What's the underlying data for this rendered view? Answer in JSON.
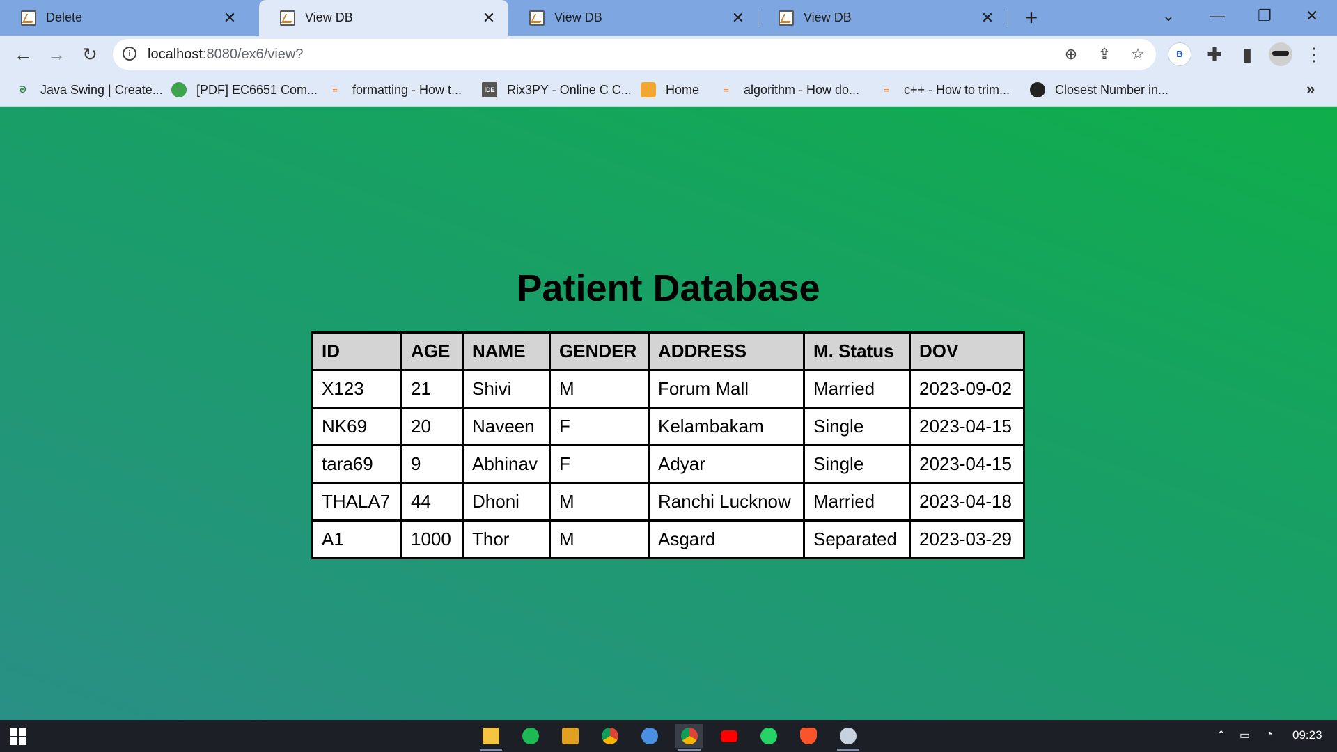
{
  "browser": {
    "tabs": [
      {
        "title": "Delete",
        "active": false
      },
      {
        "title": "View DB",
        "active": true
      },
      {
        "title": "View DB",
        "active": false
      },
      {
        "title": "View DB",
        "active": false
      }
    ],
    "new_tab_icon": "plus-icon",
    "url_host": "localhost",
    "url_path": ":8080/ex6/view?",
    "profile_initial": "B",
    "bookmarks": [
      {
        "label": "Java Swing | Create...",
        "icon": "geeksforgeeks-icon"
      },
      {
        "label": "[PDF] EC6651 Com...",
        "icon": "globe-colorful-icon"
      },
      {
        "label": "formatting - How t...",
        "icon": "stackoverflow-icon"
      },
      {
        "label": "Rix3PY - Online C C...",
        "icon": "ideone-icon"
      },
      {
        "label": "Home",
        "icon": "box-icon"
      },
      {
        "label": "algorithm - How do...",
        "icon": "stackoverflow-icon"
      },
      {
        "label": "c++ - How to trim...",
        "icon": "stackoverflow-icon"
      },
      {
        "label": "Closest Number in...",
        "icon": "globe-icon"
      }
    ]
  },
  "page": {
    "title": "Patient Database",
    "table": {
      "headers": [
        "ID",
        "AGE",
        "NAME",
        "GENDER",
        "ADDRESS",
        "M. Status",
        "DOV"
      ],
      "rows": [
        [
          "X123",
          "21",
          "Shivi",
          "M",
          "Forum Mall",
          "Married",
          "2023-09-02"
        ],
        [
          "NK69",
          "20",
          "Naveen",
          "F",
          "Kelambakam",
          "Single",
          "2023-04-15"
        ],
        [
          "tara69",
          "9",
          "Abhinav",
          "F",
          "Adyar",
          "Single",
          "2023-04-15"
        ],
        [
          "THALA7",
          "44",
          "Dhoni",
          "M",
          "Ranchi Lucknow",
          "Married",
          "2023-04-18"
        ],
        [
          "A1",
          "1000",
          "Thor",
          "M",
          "Asgard",
          "Separated",
          "2023-03-29"
        ]
      ]
    }
  },
  "taskbar": {
    "apps": [
      "file-explorer-icon",
      "spotify-icon",
      "app-icon",
      "chrome-icon",
      "spotify-icon",
      "chrome-icon",
      "youtube-icon",
      "whatsapp-icon",
      "brave-icon",
      "settings-gear-icon"
    ],
    "clock": "09:23"
  },
  "colors": {
    "tab_strip": "#7ea6e0",
    "toolbar": "#dfe9f7",
    "page_gradient_start": "#0fae4a",
    "page_gradient_end": "#2a8f86",
    "table_header_bg": "#d4d4d4"
  }
}
